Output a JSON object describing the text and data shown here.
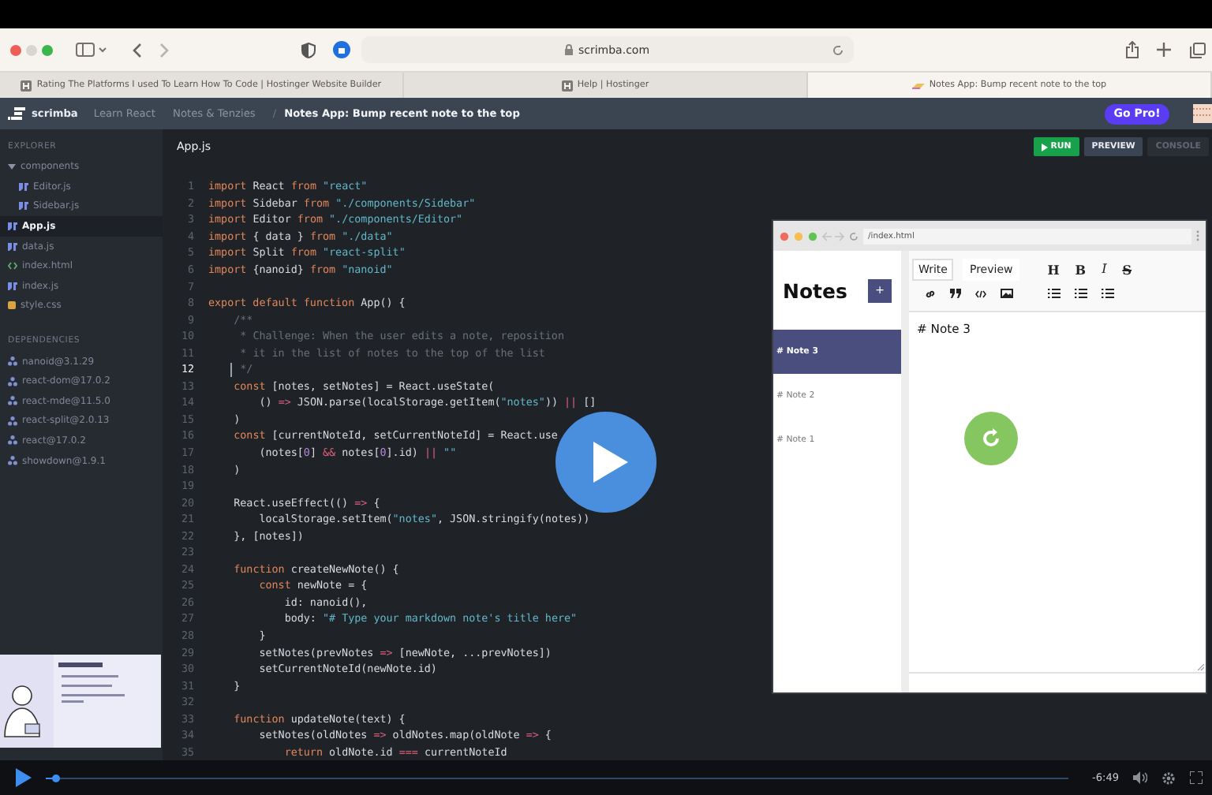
{
  "browser": {
    "address": "scrimba.com",
    "tabs": [
      {
        "title": "Rating The Platforms I used To Learn How To Code | Hostinger Website Builder",
        "selected": false
      },
      {
        "title": "Help | Hostinger",
        "selected": false
      },
      {
        "title": "Notes App: Bump recent note to the top",
        "selected": true
      }
    ]
  },
  "header": {
    "logo": "scrimba",
    "breadcrumbs": [
      {
        "kind": "link",
        "label": "Learn React"
      },
      {
        "kind": "link",
        "label": "Notes & Tenzies"
      },
      {
        "kind": "separator",
        "label": "/"
      },
      {
        "kind": "current",
        "label": "Notes App: Bump recent note to the top"
      }
    ],
    "cta": "Go Pro!"
  },
  "explorer": {
    "title": "EXPLORER",
    "files": [
      {
        "name": "components",
        "kind": "folder",
        "expanded": true,
        "selected": false,
        "children": [
          {
            "name": "Editor.js",
            "kind": "js",
            "selected": false
          },
          {
            "name": "Sidebar.js",
            "kind": "js",
            "selected": false
          }
        ]
      },
      {
        "name": "App.js",
        "kind": "js",
        "selected": true
      },
      {
        "name": "data.js",
        "kind": "js",
        "selected": false
      },
      {
        "name": "index.html",
        "kind": "html",
        "selected": false
      },
      {
        "name": "index.js",
        "kind": "js",
        "selected": false
      },
      {
        "name": "style.css",
        "kind": "css",
        "selected": false
      }
    ]
  },
  "dependencies": {
    "title": "DEPENDENCIES",
    "items": [
      "nanoid@3.1.29",
      "react-dom@17.0.2",
      "react-mde@11.5.0",
      "react-split@2.0.13",
      "react@17.0.2",
      "showdown@1.9.1"
    ]
  },
  "editor": {
    "filename": "App.js",
    "buttons": [
      {
        "label": "RUN",
        "kind": "run"
      },
      {
        "label": "PREVIEW",
        "kind": "preview"
      },
      {
        "label": "CONSOLE",
        "kind": "console"
      }
    ],
    "lines": [
      {
        "number": "1",
        "current": false,
        "tokens": [
          {
            "kind": "keyword",
            "text": "import"
          },
          {
            "kind": "plain",
            "text": " React "
          },
          {
            "kind": "keyword",
            "text": "from "
          },
          {
            "kind": "string",
            "text": "\"react\""
          }
        ]
      },
      {
        "number": "2",
        "current": false,
        "tokens": [
          {
            "kind": "keyword",
            "text": "import"
          },
          {
            "kind": "plain",
            "text": " Sidebar "
          },
          {
            "kind": "keyword",
            "text": "from "
          },
          {
            "kind": "string",
            "text": "\"./components/Sidebar\""
          }
        ]
      },
      {
        "number": "3",
        "current": false,
        "tokens": [
          {
            "kind": "keyword",
            "text": "import"
          },
          {
            "kind": "plain",
            "text": " Editor "
          },
          {
            "kind": "keyword",
            "text": "from "
          },
          {
            "kind": "string",
            "text": "\"./components/Editor\""
          }
        ]
      },
      {
        "number": "4",
        "current": false,
        "tokens": [
          {
            "kind": "keyword",
            "text": "import"
          },
          {
            "kind": "plain",
            "text": " { data } "
          },
          {
            "kind": "keyword",
            "text": "from "
          },
          {
            "kind": "string",
            "text": "\"./data\""
          }
        ]
      },
      {
        "number": "5",
        "current": false,
        "tokens": [
          {
            "kind": "keyword",
            "text": "import"
          },
          {
            "kind": "plain",
            "text": " Split "
          },
          {
            "kind": "keyword",
            "text": "from "
          },
          {
            "kind": "string",
            "text": "\"react-split\""
          }
        ]
      },
      {
        "number": "6",
        "current": false,
        "tokens": [
          {
            "kind": "keyword",
            "text": "import"
          },
          {
            "kind": "plain",
            "text": " {nanoid} "
          },
          {
            "kind": "keyword",
            "text": "from "
          },
          {
            "kind": "string",
            "text": "\"nanoid\""
          }
        ]
      },
      {
        "number": "7",
        "current": false
      },
      {
        "number": "8",
        "current": false,
        "tokens": [
          {
            "kind": "keyword",
            "text": "export default function"
          },
          {
            "kind": "plain",
            "text": " App() {"
          }
        ]
      },
      {
        "number": "9",
        "current": false,
        "tokens": [
          {
            "kind": "comment",
            "text": "    /**"
          }
        ]
      },
      {
        "number": "10",
        "current": false,
        "tokens": [
          {
            "kind": "comment",
            "text": "     * Challenge: When the user edits a note, reposition"
          }
        ]
      },
      {
        "number": "11",
        "current": false,
        "tokens": [
          {
            "kind": "comment",
            "text": "     * it in the list of notes to the top of the list"
          }
        ]
      },
      {
        "number": "12",
        "current": true,
        "tokens": [
          {
            "kind": "comment",
            "text": "     */"
          }
        ]
      },
      {
        "number": "13",
        "current": false,
        "tokens": [
          {
            "kind": "keyword",
            "text": "    const"
          },
          {
            "kind": "plain",
            "text": " [notes, setNotes] = React.useState("
          }
        ]
      },
      {
        "number": "14",
        "current": false,
        "tokens": [
          {
            "kind": "plain",
            "text": "        () "
          },
          {
            "kind": "operator",
            "text": "=>"
          },
          {
            "kind": "plain",
            "text": " JSON.parse(localStorage.getItem("
          },
          {
            "kind": "string",
            "text": "\"notes\""
          },
          {
            "kind": "plain",
            "text": ")) "
          },
          {
            "kind": "operator",
            "text": "||"
          },
          {
            "kind": "plain",
            "text": " []"
          }
        ]
      },
      {
        "number": "15",
        "current": false,
        "tokens": [
          {
            "kind": "plain",
            "text": "    )"
          }
        ]
      },
      {
        "number": "16",
        "current": false,
        "tokens": [
          {
            "kind": "keyword",
            "text": "    const"
          },
          {
            "kind": "plain",
            "text": " [currentNoteId, setCurrentNoteId] = React.use"
          }
        ]
      },
      {
        "number": "17",
        "current": false,
        "tokens": [
          {
            "kind": "plain",
            "text": "        (notes["
          },
          {
            "kind": "number",
            "text": "0"
          },
          {
            "kind": "plain",
            "text": "] "
          },
          {
            "kind": "operator",
            "text": "&&"
          },
          {
            "kind": "plain",
            "text": " notes["
          },
          {
            "kind": "number",
            "text": "0"
          },
          {
            "kind": "plain",
            "text": "].id) "
          },
          {
            "kind": "operator",
            "text": "|| "
          },
          {
            "kind": "string",
            "text": "\"\""
          }
        ]
      },
      {
        "number": "18",
        "current": false,
        "tokens": [
          {
            "kind": "plain",
            "text": "    )"
          }
        ]
      },
      {
        "number": "19",
        "current": false
      },
      {
        "number": "20",
        "current": false,
        "tokens": [
          {
            "kind": "plain",
            "text": "    React.useEffect(() "
          },
          {
            "kind": "operator",
            "text": "=>"
          },
          {
            "kind": "plain",
            "text": " {"
          }
        ]
      },
      {
        "number": "21",
        "current": false,
        "tokens": [
          {
            "kind": "plain",
            "text": "        localStorage.setItem("
          },
          {
            "kind": "string",
            "text": "\"notes\""
          },
          {
            "kind": "plain",
            "text": ", JSON.stringify(notes))"
          }
        ]
      },
      {
        "number": "22",
        "current": false,
        "tokens": [
          {
            "kind": "plain",
            "text": "    }, [notes])"
          }
        ]
      },
      {
        "number": "23",
        "current": false
      },
      {
        "number": "24",
        "current": false,
        "tokens": [
          {
            "kind": "keyword",
            "text": "    function"
          },
          {
            "kind": "plain",
            "text": " createNewNote() {"
          }
        ]
      },
      {
        "number": "25",
        "current": false,
        "tokens": [
          {
            "kind": "keyword",
            "text": "        const"
          },
          {
            "kind": "plain",
            "text": " newNote = {"
          }
        ]
      },
      {
        "number": "26",
        "current": false,
        "tokens": [
          {
            "kind": "plain",
            "text": "            id: nanoid(),"
          }
        ]
      },
      {
        "number": "27",
        "current": false,
        "tokens": [
          {
            "kind": "plain",
            "text": "            body: "
          },
          {
            "kind": "string",
            "text": "\"# Type your markdown note's title here\""
          }
        ]
      },
      {
        "number": "28",
        "current": false,
        "tokens": [
          {
            "kind": "plain",
            "text": "        }"
          }
        ]
      },
      {
        "number": "29",
        "current": false,
        "tokens": [
          {
            "kind": "plain",
            "text": "        setNotes(prevNotes "
          },
          {
            "kind": "operator",
            "text": "=>"
          },
          {
            "kind": "plain",
            "text": " [newNote, ...prevNotes])"
          }
        ]
      },
      {
        "number": "30",
        "current": false,
        "tokens": [
          {
            "kind": "plain",
            "text": "        setCurrentNoteId(newNote.id)"
          }
        ]
      },
      {
        "number": "31",
        "current": false,
        "tokens": [
          {
            "kind": "plain",
            "text": "    }"
          }
        ]
      },
      {
        "number": "32",
        "current": false
      },
      {
        "number": "33",
        "current": false,
        "tokens": [
          {
            "kind": "keyword",
            "text": "    function"
          },
          {
            "kind": "plain",
            "text": " updateNote(text) {"
          }
        ]
      },
      {
        "number": "34",
        "current": false,
        "tokens": [
          {
            "kind": "plain",
            "text": "        setNotes(oldNotes "
          },
          {
            "kind": "operator",
            "text": "=>"
          },
          {
            "kind": "plain",
            "text": " oldNotes.map(oldNote "
          },
          {
            "kind": "operator",
            "text": "=>"
          },
          {
            "kind": "plain",
            "text": " {"
          }
        ]
      },
      {
        "number": "35",
        "current": false,
        "tokens": [
          {
            "kind": "keyword",
            "text": "            return"
          },
          {
            "kind": "plain",
            "text": " oldNote.id "
          },
          {
            "kind": "operator",
            "text": "==="
          },
          {
            "kind": "plain",
            "text": " currentNoteId"
          }
        ]
      }
    ]
  },
  "preview": {
    "address": "/index.html",
    "title": "Notes",
    "add_label": "+",
    "notes": [
      {
        "title": "# Note 3",
        "selected": true
      },
      {
        "title": "# Note 2",
        "selected": false
      },
      {
        "title": "# Note 1",
        "selected": false
      }
    ],
    "tabs": [
      {
        "label": "Write",
        "selected": true
      },
      {
        "label": "Preview",
        "selected": false
      }
    ],
    "format_buttons": [
      {
        "label": "H",
        "kind": "heading"
      },
      {
        "label": "B",
        "kind": "bold"
      },
      {
        "label": "I",
        "kind": "italic"
      },
      {
        "label": "S",
        "kind": "strikethrough"
      }
    ],
    "content": "# Note 3"
  },
  "player": {
    "time": "-6:49",
    "level": 0.01
  }
}
